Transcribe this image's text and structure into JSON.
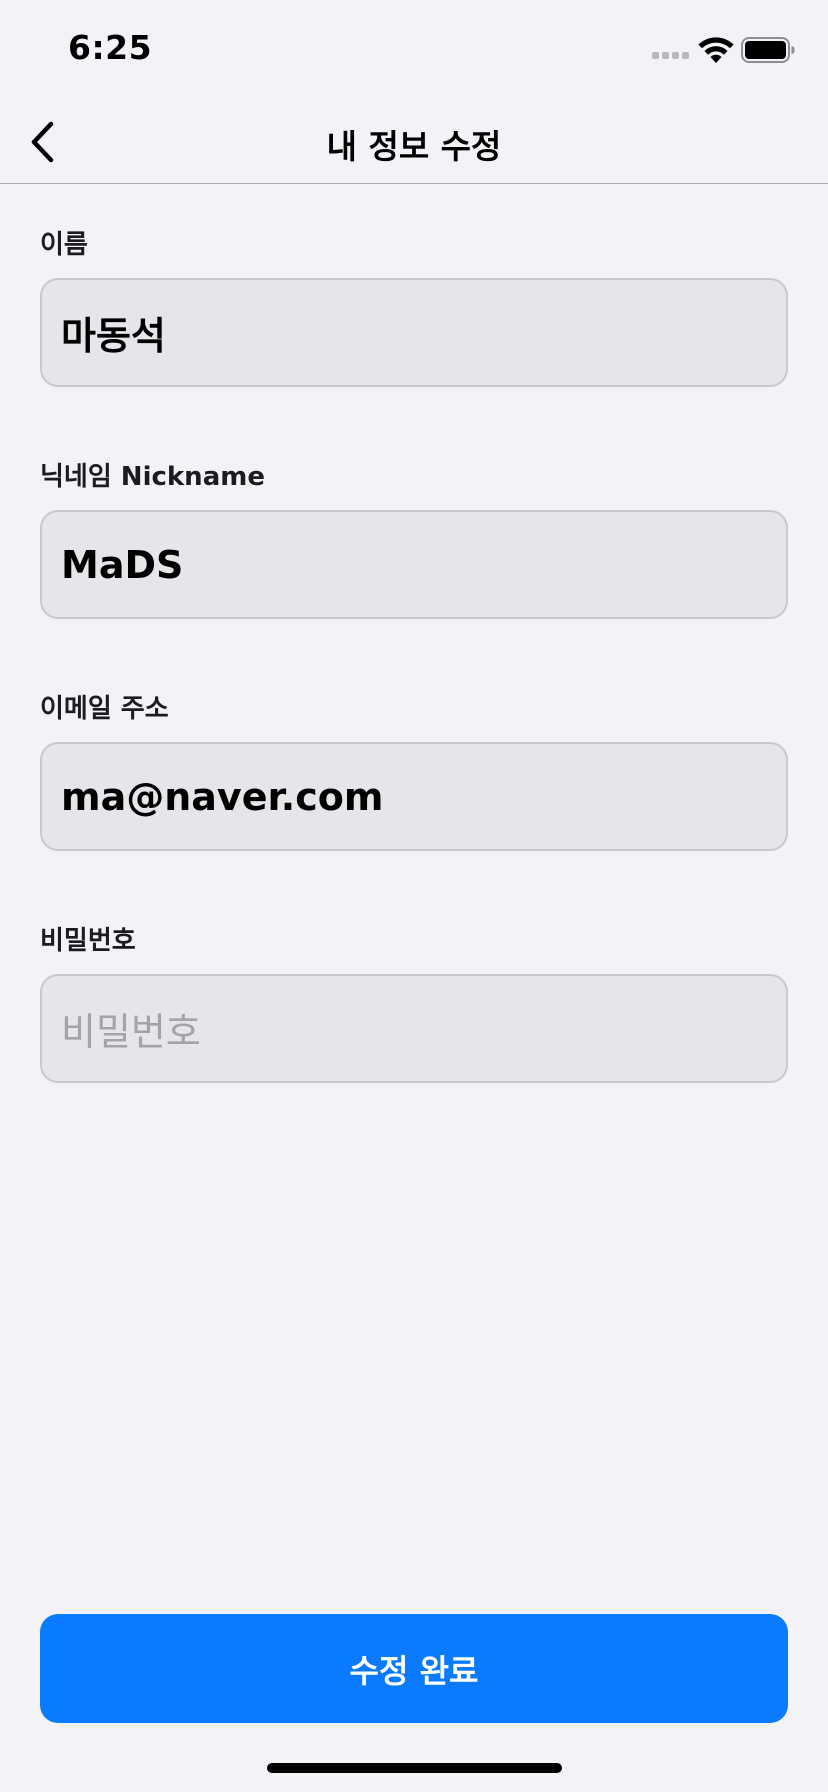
{
  "status_bar": {
    "time": "6:25",
    "icons": [
      "signal-icon",
      "wifi-icon",
      "battery-icon"
    ]
  },
  "nav": {
    "title": "내 정보 수정",
    "back_icon": "chevron-left-icon"
  },
  "form": {
    "name": {
      "label": "이름",
      "value": "마동석"
    },
    "nickname": {
      "label": "닉네임 Nickname",
      "value": "MaDS"
    },
    "email": {
      "label": "이메일 주소",
      "value": "ma@naver.com"
    },
    "password": {
      "label": "비밀번호",
      "value": "",
      "placeholder": "비밀번호"
    }
  },
  "submit": {
    "label": "수정 완료"
  },
  "colors": {
    "background": "#f2f2f7",
    "field_background": "#e5e5ea",
    "accent": "#0a7aff"
  }
}
